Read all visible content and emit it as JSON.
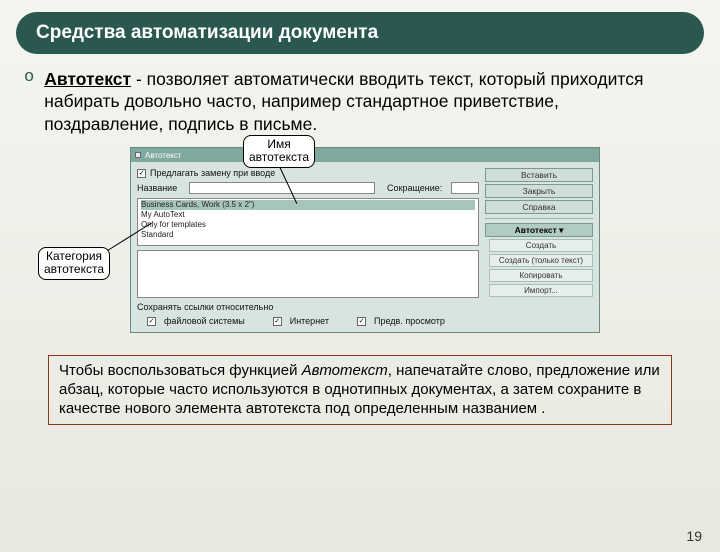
{
  "slide": {
    "title": "Средства автоматизации документа",
    "page_number": "19"
  },
  "bullet": {
    "term": "Автотекст",
    "rest": " - позволяет автоматически вводить текст, который приходится набирать довольно часто, например стандартное приветствие, поздравление, подпись в письме."
  },
  "dialog": {
    "title": "Автотекст",
    "checkbox_label": "Предлагать замену при вводе",
    "name_label": "Название",
    "name_value": "—",
    "shortcut_label": "Сокращение:",
    "shortcut_value": "—",
    "list_items": [
      "Business Cards, Work (3.5 x 2\")",
      "My AutoText",
      "Only for templates",
      "Standard"
    ],
    "save_links_label": "Сохранять ссылки относительно",
    "radios": [
      "файловой системы",
      "Интернет"
    ],
    "preview_check": "Предв. просмотр"
  },
  "buttons": {
    "insert": "Вставить",
    "close": "Закрыть",
    "help": "Справка",
    "autotext": "Автотекст ▾",
    "new": "Создать",
    "new_text": "Создать (только текст)",
    "copy": "Копировать",
    "import": "Импорт..."
  },
  "callouts": {
    "name": "Имя\nавтотекста",
    "category": "Категория\nавтотекста"
  },
  "note": {
    "prefix": "Чтобы воспользоваться функцией ",
    "em": "Автотекст",
    "rest": ", напечатайте слово, предложение или абзац, которые часто используются в однотипных документах, а затем сохраните в качестве нового элемента автотекста под определенным названием ."
  }
}
